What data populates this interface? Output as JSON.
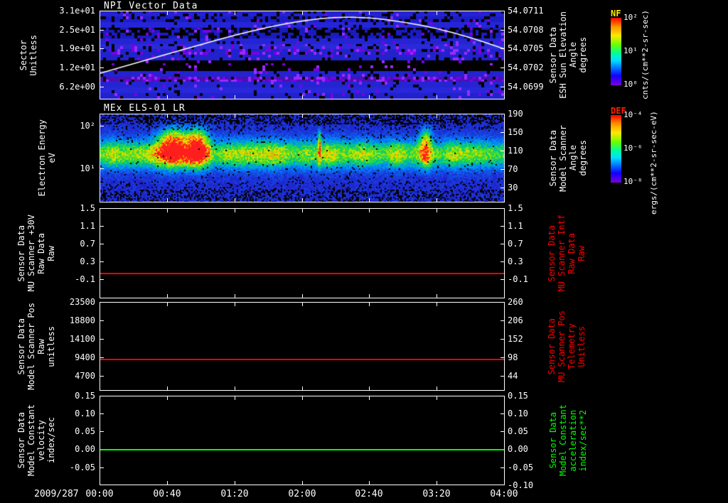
{
  "colors": {
    "background": "#000000",
    "axis_foreground": "#ffffff",
    "red_series": "#ff0000",
    "green_series": "#00ff00"
  },
  "time_axis": {
    "date_label": "2009/287",
    "ticks": [
      "00:00",
      "00:40",
      "01:20",
      "02:00",
      "02:40",
      "03:20",
      "04:00"
    ],
    "start_hour": 0,
    "end_hour": 4
  },
  "chart_data": [
    {
      "type": "heatmap",
      "title": "NPI Vector Data",
      "ylabel_lines": [
        "Sector",
        "Unitless"
      ],
      "yticks": [
        "3.1e+01",
        "2.5e+01",
        "1.9e+01",
        "1.2e+01",
        "6.2e+00"
      ],
      "right_axis": {
        "label_lines": [
          "Sensor Data",
          "ESH Sun Elevation",
          "Angle",
          "degrees"
        ],
        "label_color": "#ffffff",
        "ticks": [
          "54.0711",
          "54.0708",
          "54.0705",
          "54.0702",
          "54.0699"
        ],
        "ylim": [
          54.0697,
          54.0711
        ]
      },
      "colorbar": {
        "name": "NF",
        "name_color": "#ffee00",
        "ticks": [
          "10²",
          "10¹",
          "10⁰"
        ],
        "units": "cnts/(cm**2-sr-sec)"
      },
      "overlay_line": {
        "name": "ESH Sun Elevation Angle",
        "color": "#ffffff",
        "x_hours": [
          0,
          0.33,
          0.67,
          1.0,
          1.33,
          1.67,
          2.0,
          2.33,
          2.67,
          3.0,
          3.33,
          3.67,
          4.0
        ],
        "values": [
          54.07011,
          54.07026,
          54.07042,
          54.07057,
          54.07072,
          54.07085,
          54.07095,
          54.07101,
          54.071,
          54.07093,
          54.07083,
          54.07068,
          54.0705
        ]
      }
    },
    {
      "type": "heatmap",
      "title": "MEx ELS-01 LR",
      "ylabel_lines": [
        "Electron Energy",
        "eV"
      ],
      "yticks": [
        "10²",
        "10¹"
      ],
      "yscale": "log",
      "right_axis": {
        "label_lines": [
          "Sensor Data",
          "Model Scanner",
          "Angle",
          "degrees"
        ],
        "label_color": "#ffffff",
        "ticks": [
          "190",
          "150",
          "110",
          "70",
          "30"
        ]
      },
      "colorbar": {
        "name": "DEF",
        "name_color": "#ff2200",
        "ticks": [
          "10⁻⁴",
          "10⁻⁶",
          "10⁻⁸"
        ],
        "units": "ergs/(cm**2-sr-sec-eV)"
      },
      "spectral_features": {
        "main_band_eV": [
          10,
          50
        ],
        "burst_intervals_hours": [
          [
            0.6,
            0.85
          ],
          [
            0.87,
            1.05
          ],
          [
            2.15,
            2.18
          ],
          [
            3.17,
            3.27
          ]
        ],
        "burst_strengths": [
          0.9,
          0.85,
          0.5,
          0.65
        ]
      }
    },
    {
      "type": "line",
      "ylabel_lines": [
        "Sensor Data",
        "MU Scanner +30V",
        "Raw Data",
        "Raw"
      ],
      "yticks": [
        "1.5",
        "1.1",
        "0.7",
        "0.3",
        "-0.1"
      ],
      "ylim": [
        -0.5,
        1.5
      ],
      "series": [
        {
          "name": "MU Scanner +30V Raw Data",
          "color": "#ff0000",
          "value": 0.05
        }
      ],
      "right_axis": {
        "label_lines": [
          "Sensor Data",
          "MU Scanner Intf",
          "Raw Data",
          "Raw"
        ],
        "label_color": "#ff0000",
        "ticks": [
          "1.5",
          "1.1",
          "0.7",
          "0.3",
          "-0.1"
        ]
      }
    },
    {
      "type": "line",
      "ylabel_lines": [
        "Sensor Data",
        "Model Scanner Pos",
        "Raw",
        "unitless"
      ],
      "yticks": [
        "23500",
        "18800",
        "14100",
        "9400",
        "4700"
      ],
      "ylim": [
        0,
        23500
      ],
      "series": [
        {
          "name": "Model Scanner Pos Raw",
          "color": "#ff0000",
          "value": 8200
        }
      ],
      "right_axis": {
        "label_lines": [
          "Sensor Data",
          "MU Scanner Pos",
          "Telemetry",
          "Unitless"
        ],
        "label_color": "#ff0000",
        "ticks": [
          "260",
          "206",
          "152",
          "98",
          "44"
        ]
      }
    },
    {
      "type": "line",
      "ylabel_lines": [
        "Sensor Data",
        "Model Constant",
        "velocity",
        "index/sec"
      ],
      "yticks": [
        "0.15",
        "0.10",
        "0.05",
        "0.00",
        "-0.05"
      ],
      "ylim": [
        -0.1,
        0.15
      ],
      "series": [
        {
          "name": "Model Constant velocity",
          "color": "#00ff00",
          "value": 0.0
        }
      ],
      "right_axis": {
        "label_lines": [
          "Sensor Data",
          "Model Constant",
          "acceleration",
          "index/sec**2"
        ],
        "label_color": "#00ff00",
        "ticks": [
          "0.15",
          "0.10",
          "0.05",
          "0.00",
          "-0.05",
          "-0.10"
        ]
      }
    }
  ]
}
